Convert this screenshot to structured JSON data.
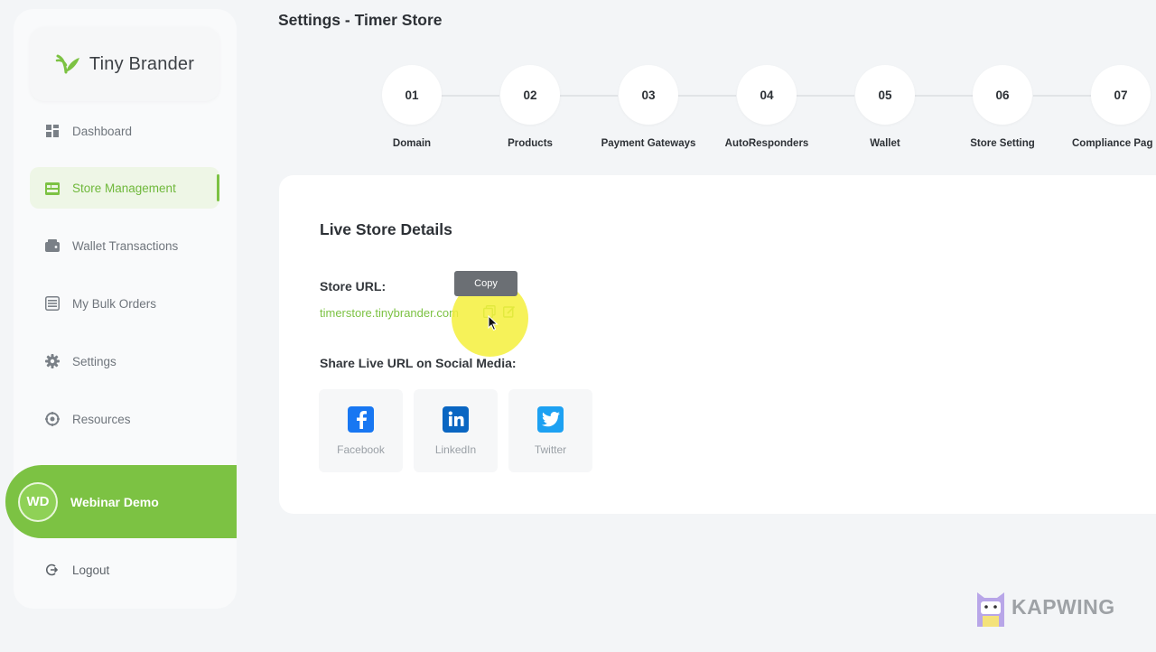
{
  "sidebar": {
    "logo_text": "Tiny Brander",
    "items": [
      {
        "label": "Dashboard",
        "icon": "grid-icon"
      },
      {
        "label": "Store Management",
        "icon": "store-icon",
        "active": true
      },
      {
        "label": "Wallet Transactions",
        "icon": "wallet-icon"
      },
      {
        "label": "My Bulk Orders",
        "icon": "list-icon"
      },
      {
        "label": "Settings",
        "icon": "gear-icon"
      },
      {
        "label": "Resources",
        "icon": "resources-icon"
      }
    ],
    "user": {
      "initials": "WD",
      "name": "Webinar Demo"
    },
    "logout_label": "Logout"
  },
  "header": {
    "title": "Settings - Timer Store"
  },
  "steps": [
    {
      "number": "01",
      "label": "Domain"
    },
    {
      "number": "02",
      "label": "Products"
    },
    {
      "number": "03",
      "label": "Payment Gateways"
    },
    {
      "number": "04",
      "label": "AutoResponders"
    },
    {
      "number": "05",
      "label": "Wallet"
    },
    {
      "number": "06",
      "label": "Store Setting"
    },
    {
      "number": "07",
      "label": "Compliance Pag"
    }
  ],
  "card": {
    "title": "Live Store Details",
    "store_url_label": "Store URL:",
    "store_url": "timerstore.tinybrander.com",
    "tooltip": "Copy",
    "share_label": "Share Live URL on Social Media:",
    "social": [
      {
        "name": "Facebook",
        "color": "#1877f2"
      },
      {
        "name": "LinkedIn",
        "color": "#0a66c2"
      },
      {
        "name": "Twitter",
        "color": "#1da1f2"
      }
    ]
  },
  "watermark": "KAPWING",
  "colors": {
    "accent": "#7cc243",
    "background": "#f3f5f7"
  }
}
